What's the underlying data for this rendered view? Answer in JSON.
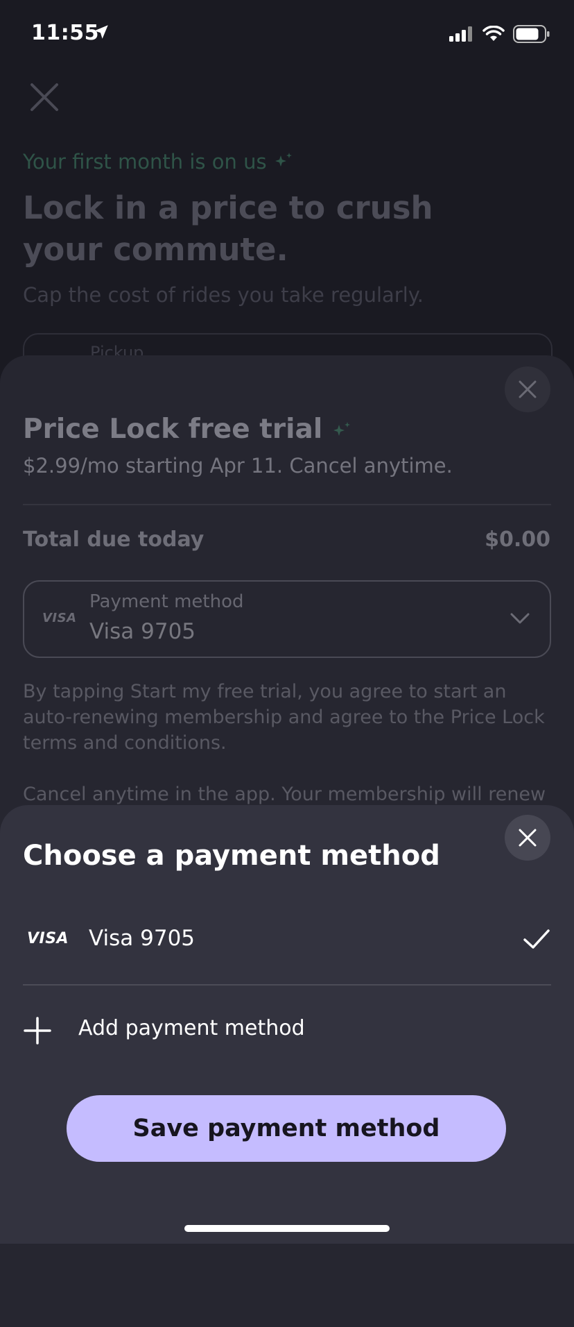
{
  "status_bar": {
    "time": "11:55"
  },
  "background_page": {
    "promo": "Your first month is on us",
    "title": "Lock in a price to crush your commute.",
    "subtitle": "Cap the cost of rides you take regularly.",
    "input_label": "Pickup"
  },
  "trial_sheet": {
    "title": "Price Lock free trial",
    "subtitle": "$2.99/mo starting Apr 11. Cancel anytime.",
    "total_label": "Total due today",
    "total_value": "$0.00",
    "payment": {
      "brand": "VISA",
      "label": "Payment method",
      "value": "Visa 9705"
    },
    "terms": "By tapping Start my free trial, you agree to start an auto-renewing membership and agree to the Price Lock terms and conditions.",
    "cancel_note": "Cancel anytime in the app. Your membership will renew"
  },
  "payment_sheet": {
    "title": "Choose a payment method",
    "options": [
      {
        "brand": "VISA",
        "label": "Visa 9705",
        "selected": true
      }
    ],
    "add_label": "Add payment method",
    "save_label": "Save payment method"
  },
  "colors": {
    "accent": "#c5bcff",
    "sheet": "#33333f",
    "background": "#1a1a22"
  },
  "icons": [
    "location-arrow-icon",
    "signal-icon",
    "wifi-icon",
    "battery-icon",
    "close-icon",
    "sparkle-icon",
    "chevron-down-icon",
    "checkmark-icon",
    "plus-icon"
  ]
}
